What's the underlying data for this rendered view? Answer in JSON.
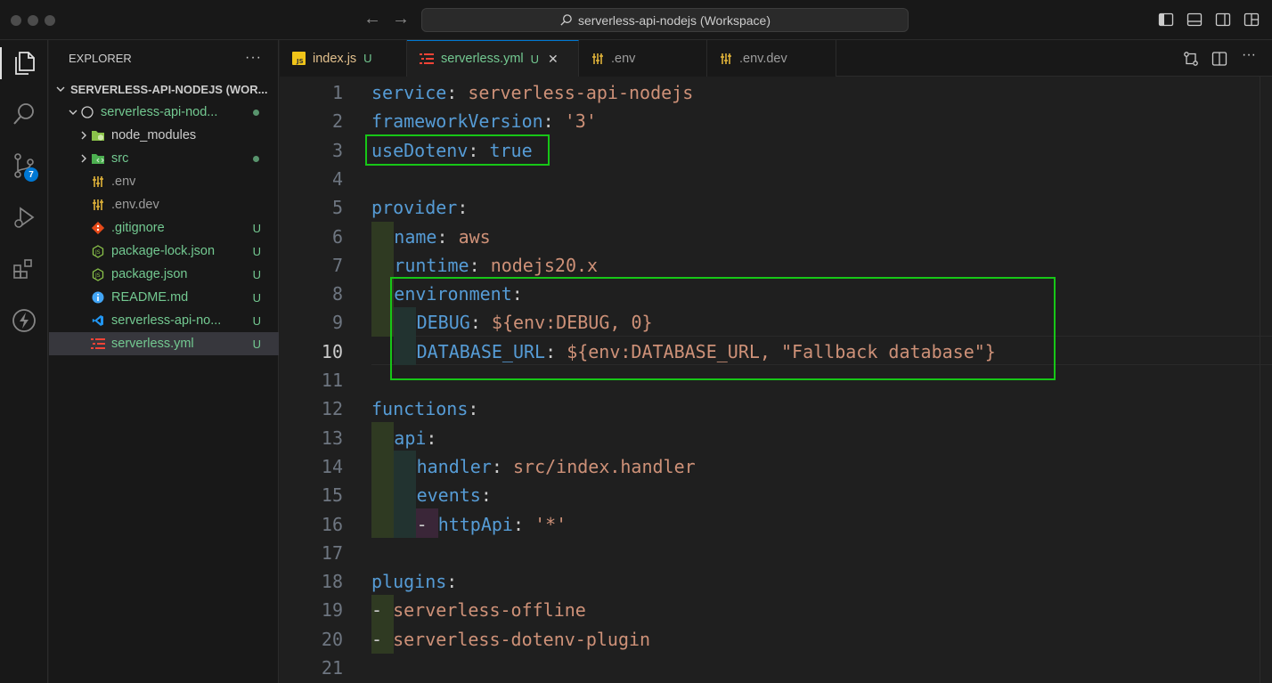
{
  "window": {
    "title": "serverless-api-nodejs (Workspace)"
  },
  "sidebar": {
    "title": "EXPLORER",
    "more": "···",
    "workspace_label": "SERVERLESS-API-NODEJS (WOR...",
    "items": [
      {
        "label": "serverless-api-nod...",
        "status": "",
        "icon": "folder-outline-icon"
      },
      {
        "label": "node_modules",
        "status": "",
        "icon": "folder-node-icon"
      },
      {
        "label": "src",
        "status": "",
        "icon": "folder-src-icon"
      },
      {
        "label": ".env",
        "status": "",
        "icon": "env-file-icon"
      },
      {
        "label": ".env.dev",
        "status": "",
        "icon": "env-file-icon"
      },
      {
        "label": ".gitignore",
        "status": "U",
        "icon": "git-icon"
      },
      {
        "label": "package-lock.json",
        "status": "U",
        "icon": "nodejs-icon"
      },
      {
        "label": "package.json",
        "status": "U",
        "icon": "nodejs-icon"
      },
      {
        "label": "README.md",
        "status": "U",
        "icon": "info-icon"
      },
      {
        "label": "serverless-api-no...",
        "status": "U",
        "icon": "vscode-icon"
      },
      {
        "label": "serverless.yml",
        "status": "U",
        "icon": "yaml-icon"
      }
    ]
  },
  "activity": {
    "scm_badge": "7"
  },
  "tabs": [
    {
      "label": "index.js",
      "status": "U",
      "icon": "js-icon"
    },
    {
      "label": "serverless.yml",
      "status": "U",
      "icon": "yaml-icon",
      "close": "✕"
    },
    {
      "label": ".env",
      "status": "",
      "icon": "env-file-icon"
    },
    {
      "label": ".env.dev",
      "status": "",
      "icon": "env-file-icon"
    }
  ],
  "editor": {
    "current_line": 10,
    "lines": [
      {
        "n": "1",
        "key": "service",
        "value": "serverless-api-nodejs"
      },
      {
        "n": "2",
        "key": "frameworkVersion",
        "value": "'3'"
      },
      {
        "n": "3",
        "key": "useDotenv",
        "value": "true"
      },
      {
        "n": "4"
      },
      {
        "n": "5",
        "key": "provider"
      },
      {
        "n": "6",
        "key": "name",
        "value": "aws"
      },
      {
        "n": "7",
        "key": "runtime",
        "value": "nodejs20.x"
      },
      {
        "n": "8",
        "key": "environment"
      },
      {
        "n": "9",
        "key": "DEBUG",
        "value": "${env:DEBUG, 0}"
      },
      {
        "n": "10",
        "key": "DATABASE_URL",
        "value": "${env:DATABASE_URL, \"Fallback database\"}"
      },
      {
        "n": "11"
      },
      {
        "n": "12",
        "key": "functions"
      },
      {
        "n": "13",
        "key": "api"
      },
      {
        "n": "14",
        "key": "handler",
        "value": "src/index.handler"
      },
      {
        "n": "15",
        "key": "events"
      },
      {
        "n": "16",
        "dash": "-",
        "key": "httpApi",
        "value": "'*'"
      },
      {
        "n": "17"
      },
      {
        "n": "18",
        "key": "plugins"
      },
      {
        "n": "19",
        "dash": "-",
        "value": "serverless-offline"
      },
      {
        "n": "20",
        "dash": "-",
        "value": "serverless-dotenv-plugin"
      },
      {
        "n": "21"
      }
    ]
  },
  "colors": {
    "key": "#569cd6",
    "string": "#ce9178",
    "highlight_box": "#17c617",
    "untracked": "#73c991"
  }
}
